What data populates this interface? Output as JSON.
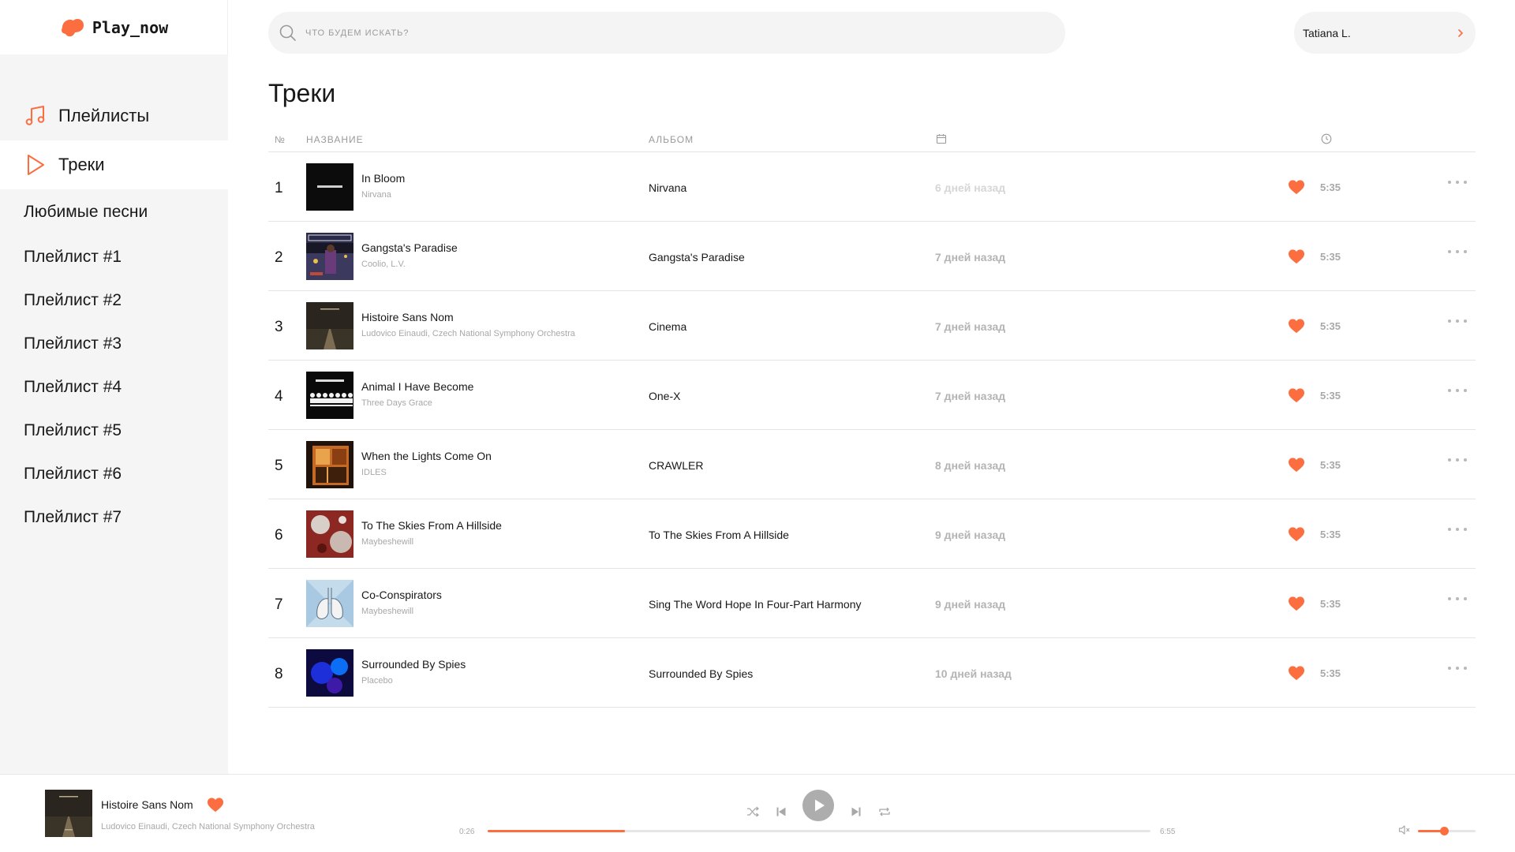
{
  "app": {
    "logo": "Play_now",
    "accent": "#fc6d3f"
  },
  "sidebar": {
    "nav": [
      {
        "label": "Плейлисты",
        "icon": "music-note-icon"
      },
      {
        "label": "Треки",
        "icon": "play-outline-icon"
      }
    ],
    "playlists": [
      "Любимые песни",
      "Плейлист #1",
      "Плейлист #2",
      "Плейлист #3",
      "Плейлист #4",
      "Плейлист #5",
      "Плейлист #6",
      "Плейлист #7"
    ]
  },
  "search": {
    "placeholder": "ЧТО БУДЕМ ИСКАТЬ?"
  },
  "user": {
    "name": "Tatiana L."
  },
  "main": {
    "title": "Треки",
    "columns": {
      "num": "№",
      "title": "НАЗВАНИЕ",
      "album": "АЛЬБОМ"
    }
  },
  "tracks": [
    {
      "num": "1",
      "title": "In Bloom",
      "artist": "Nirvana",
      "album": "Nirvana",
      "added": "6 дней назад",
      "duration": "5:35",
      "cover": "black"
    },
    {
      "num": "2",
      "title": "Gangsta's Paradise",
      "artist": "Coolio, L.V.",
      "album": "Gangsta's Paradise",
      "added": "7 дней назад",
      "duration": "5:35",
      "cover": "coolio"
    },
    {
      "num": "3",
      "title": "Histoire Sans Nom",
      "artist": "Ludovico Einaudi, Czech National Symphony Orchestra",
      "album": "Cinema",
      "added": "7 дней назад",
      "duration": "5:35",
      "cover": "road"
    },
    {
      "num": "4",
      "title": "Animal I Have Become",
      "artist": "Three Days Grace",
      "album": "One-X",
      "added": "7 дней назад",
      "duration": "5:35",
      "cover": "figures"
    },
    {
      "num": "5",
      "title": "When the Lights Come On",
      "artist": "IDLES",
      "album": "CRAWLER",
      "added": "8 дней назад",
      "duration": "5:35",
      "cover": "window"
    },
    {
      "num": "6",
      "title": "To The Skies From A Hillside",
      "artist": "Maybeshewill",
      "album": "To The Skies From A Hillside",
      "added": "9 дней назад",
      "duration": "5:35",
      "cover": "red"
    },
    {
      "num": "7",
      "title": "Co-Conspirators",
      "artist": "Maybeshewill",
      "album": "Sing The Word Hope In Four-Part Harmony",
      "added": "9 дней назад",
      "duration": "5:35",
      "cover": "lungs"
    },
    {
      "num": "8",
      "title": "Surrounded By Spies",
      "artist": "Placebo",
      "album": "Surrounded By Spies",
      "added": "10 дней назад",
      "duration": "5:35",
      "cover": "blue"
    }
  ],
  "player": {
    "title": "Histoire Sans Nom",
    "artist": "Ludovico Einaudi, Czech National Symphony Orchestra",
    "current_time": "0:26",
    "total_time": "6:55",
    "progress": 0.207,
    "volume": 0.45
  }
}
